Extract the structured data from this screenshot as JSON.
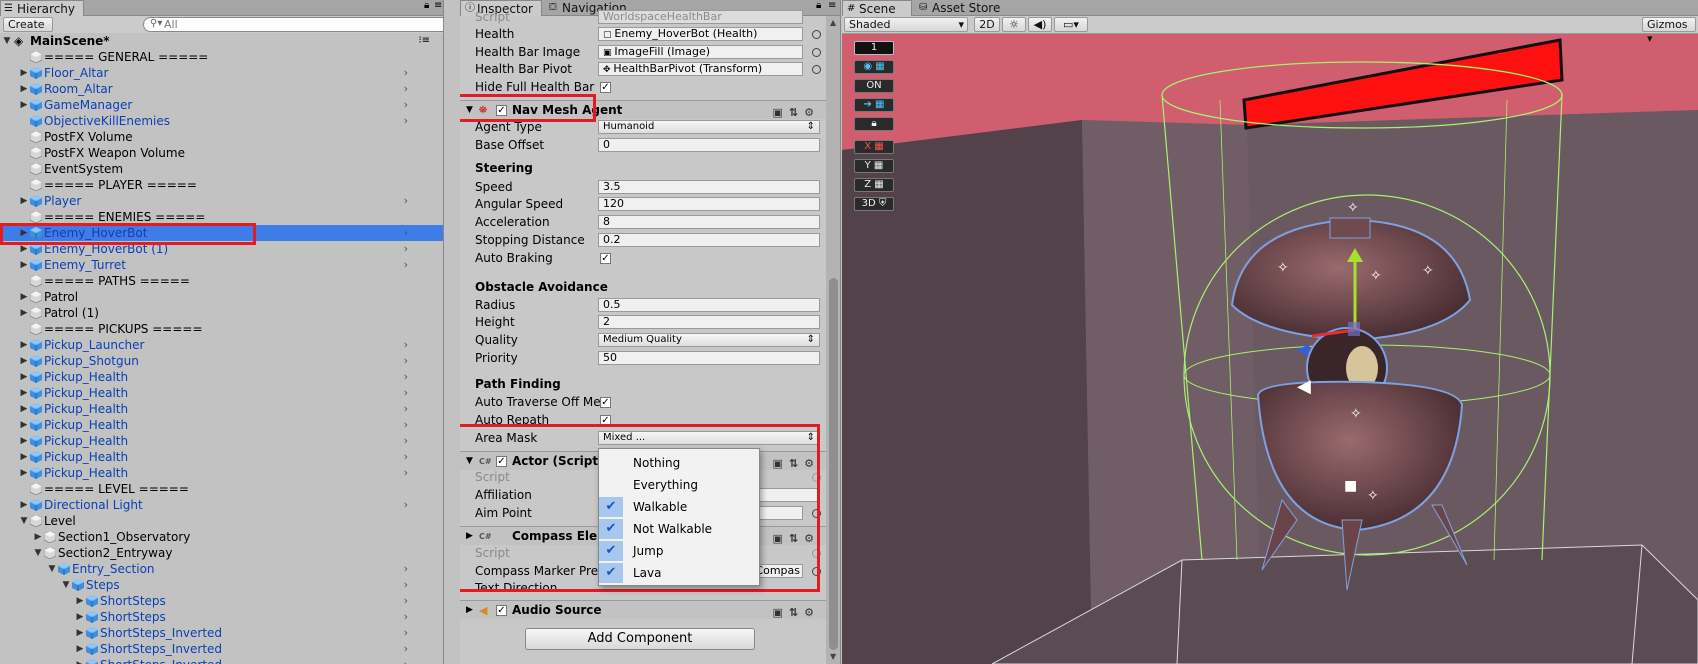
{
  "hierarchy": {
    "tab_label": "Hierarchy",
    "create_label": "Create",
    "search_placeholder": "All",
    "scene_name": "MainScene*",
    "items": [
      {
        "label": "===== GENERAL =====",
        "depth": 1,
        "arrow": "",
        "prefab": false,
        "chev": false
      },
      {
        "label": "Floor_Altar",
        "depth": 1,
        "arrow": "right",
        "prefab": true,
        "chev": true
      },
      {
        "label": "Room_Altar",
        "depth": 1,
        "arrow": "right",
        "prefab": true,
        "chev": true
      },
      {
        "label": "GameManager",
        "depth": 1,
        "arrow": "right",
        "prefab": true,
        "chev": true
      },
      {
        "label": "ObjectiveKillEnemies",
        "depth": 1,
        "arrow": "",
        "prefab": true,
        "chev": true
      },
      {
        "label": "PostFX Volume",
        "depth": 1,
        "arrow": "",
        "prefab": false,
        "chev": false
      },
      {
        "label": "PostFX Weapon Volume",
        "depth": 1,
        "arrow": "",
        "prefab": false,
        "chev": false
      },
      {
        "label": "EventSystem",
        "depth": 1,
        "arrow": "",
        "prefab": false,
        "chev": false
      },
      {
        "label": "===== PLAYER =====",
        "depth": 1,
        "arrow": "",
        "prefab": false,
        "chev": false
      },
      {
        "label": "Player",
        "depth": 1,
        "arrow": "right",
        "prefab": true,
        "chev": true
      },
      {
        "label": "===== ENEMIES =====",
        "depth": 1,
        "arrow": "",
        "prefab": false,
        "chev": false
      },
      {
        "label": "Enemy_HoverBot",
        "depth": 1,
        "arrow": "right",
        "prefab": true,
        "chev": true,
        "selected": true
      },
      {
        "label": "Enemy_HoverBot (1)",
        "depth": 1,
        "arrow": "right",
        "prefab": true,
        "chev": true
      },
      {
        "label": "Enemy_Turret",
        "depth": 1,
        "arrow": "right",
        "prefab": true,
        "chev": true
      },
      {
        "label": "===== PATHS =====",
        "depth": 1,
        "arrow": "",
        "prefab": false,
        "chev": false
      },
      {
        "label": "Patrol",
        "depth": 1,
        "arrow": "right",
        "prefab": false,
        "chev": false
      },
      {
        "label": "Patrol (1)",
        "depth": 1,
        "arrow": "right",
        "prefab": false,
        "chev": false
      },
      {
        "label": "===== PICKUPS =====",
        "depth": 1,
        "arrow": "",
        "prefab": false,
        "chev": false
      },
      {
        "label": "Pickup_Launcher",
        "depth": 1,
        "arrow": "right",
        "prefab": true,
        "chev": true
      },
      {
        "label": "Pickup_Shotgun",
        "depth": 1,
        "arrow": "right",
        "prefab": true,
        "chev": true
      },
      {
        "label": "Pickup_Health",
        "depth": 1,
        "arrow": "right",
        "prefab": true,
        "chev": true
      },
      {
        "label": "Pickup_Health",
        "depth": 1,
        "arrow": "right",
        "prefab": true,
        "chev": true
      },
      {
        "label": "Pickup_Health",
        "depth": 1,
        "arrow": "right",
        "prefab": true,
        "chev": true
      },
      {
        "label": "Pickup_Health",
        "depth": 1,
        "arrow": "right",
        "prefab": true,
        "chev": true
      },
      {
        "label": "Pickup_Health",
        "depth": 1,
        "arrow": "right",
        "prefab": true,
        "chev": true
      },
      {
        "label": "Pickup_Health",
        "depth": 1,
        "arrow": "right",
        "prefab": true,
        "chev": true
      },
      {
        "label": "Pickup_Health",
        "depth": 1,
        "arrow": "right",
        "prefab": true,
        "chev": true
      },
      {
        "label": "===== LEVEL =====",
        "depth": 1,
        "arrow": "",
        "prefab": false,
        "chev": false
      },
      {
        "label": "Directional Light",
        "depth": 1,
        "arrow": "right",
        "prefab": true,
        "chev": true
      },
      {
        "label": "Level",
        "depth": 1,
        "arrow": "down",
        "prefab": false,
        "chev": false
      },
      {
        "label": "Section1_Observatory",
        "depth": 2,
        "arrow": "right",
        "prefab": false,
        "chev": false
      },
      {
        "label": "Section2_Entryway",
        "depth": 2,
        "arrow": "down",
        "prefab": false,
        "chev": false
      },
      {
        "label": "Entry_Section",
        "depth": 3,
        "arrow": "down",
        "prefab": true,
        "chev": true
      },
      {
        "label": "Steps",
        "depth": 4,
        "arrow": "down",
        "prefab": true,
        "chev": true
      },
      {
        "label": "ShortSteps",
        "depth": 5,
        "arrow": "right",
        "prefab": true,
        "chev": true
      },
      {
        "label": "ShortSteps",
        "depth": 5,
        "arrow": "right",
        "prefab": true,
        "chev": true
      },
      {
        "label": "ShortSteps_Inverted",
        "depth": 5,
        "arrow": "right",
        "prefab": true,
        "chev": true
      },
      {
        "label": "ShortSteps_Inverted",
        "depth": 5,
        "arrow": "right",
        "prefab": true,
        "chev": true
      },
      {
        "label": "ShortSteps_Inverted",
        "depth": 5,
        "arrow": "right",
        "prefab": true,
        "chev": true
      }
    ]
  },
  "inspector": {
    "tab_inspector": "Inspector",
    "tab_navigation": "Navigation",
    "health": {
      "script_label": "Script",
      "script_value": "WorldspaceHealthBar",
      "health_label": "Health",
      "health_value": "Enemy_HoverBot (Health)",
      "bar_image_label": "Health Bar Image",
      "bar_image_value": "ImageFill (Image)",
      "bar_pivot_label": "Health Bar Pivot",
      "bar_pivot_value": "HealthBarPivot (Transform)",
      "hide_full_label": "Hide Full Health Bar"
    },
    "nav_mesh_agent": {
      "title": "Nav Mesh Agent",
      "agent_type_label": "Agent Type",
      "agent_type_value": "Humanoid",
      "base_offset_label": "Base Offset",
      "base_offset_value": "0",
      "steering_header": "Steering",
      "speed_label": "Speed",
      "speed_value": "3.5",
      "angular_label": "Angular Speed",
      "angular_value": "120",
      "accel_label": "Acceleration",
      "accel_value": "8",
      "stopping_label": "Stopping Distance",
      "stopping_value": "0.2",
      "auto_braking_label": "Auto Braking",
      "obstacle_header": "Obstacle Avoidance",
      "radius_label": "Radius",
      "radius_value": "0.5",
      "height_label": "Height",
      "height_value": "2",
      "quality_label": "Quality",
      "quality_value": "Medium Quality",
      "priority_label": "Priority",
      "priority_value": "50",
      "path_header": "Path Finding",
      "auto_traverse_label": "Auto Traverse Off Me",
      "auto_repath_label": "Auto Repath",
      "area_mask_label": "Area Mask",
      "area_mask_value": "Mixed ..."
    },
    "actor": {
      "title": "Actor (Script)",
      "script_label": "Script",
      "affiliation_label": "Affiliation",
      "aim_point_label": "Aim Point"
    },
    "compass": {
      "title": "Compass Elem",
      "script_label": "Script",
      "marker_label": "Compass Marker Pref",
      "marker_value": "Compas",
      "text_dir_label": "Text Direction"
    },
    "audio_source_title": "Audio Source",
    "add_component_label": "Add Component",
    "area_mask_options": [
      {
        "label": "Nothing",
        "checked": false
      },
      {
        "label": "Everything",
        "checked": false
      },
      {
        "label": "Walkable",
        "checked": true
      },
      {
        "label": "Not Walkable",
        "checked": true
      },
      {
        "label": "Jump",
        "checked": true
      },
      {
        "label": "Lava",
        "checked": true
      }
    ]
  },
  "scene": {
    "tab_scene": "Scene",
    "tab_asset_store": "Asset Store",
    "shading_mode": "Shaded",
    "mode_2d": "2D",
    "gizmos_label": "Gizmos",
    "overlay": {
      "layer_number": "1",
      "on_label": "ON",
      "x_label": "X",
      "y_label": "Y",
      "z_label": "Z",
      "view_3d_label": "3D"
    },
    "colors": {
      "highlight_red": "#e31b23",
      "selection_blue": "#3e7de7",
      "health_bar_red": "#ff1010",
      "wire_green": "#a8f070"
    }
  }
}
